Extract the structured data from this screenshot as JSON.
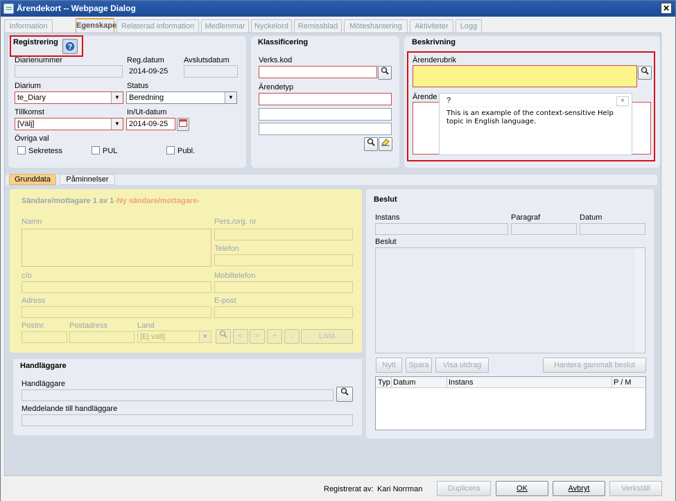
{
  "window": {
    "title": "Ärendekort -- Webpage Dialog",
    "close": "✕"
  },
  "tabs": [
    {
      "label": "Information",
      "active": false
    },
    {
      "label": "Egenskaper",
      "active": true
    },
    {
      "label": "Relaterad information",
      "active": false
    },
    {
      "label": "Medlemmar",
      "active": false
    },
    {
      "label": "Nyckelord",
      "active": false
    },
    {
      "label": "Remissblad",
      "active": false
    },
    {
      "label": "Möteshantering",
      "active": false
    },
    {
      "label": "Aktiviteter",
      "active": false
    },
    {
      "label": "Logg",
      "active": false
    }
  ],
  "registrering": {
    "title": "Registrering",
    "help_icon": "question-circle-icon",
    "diarienummer_label": "Diarienummer",
    "diarienummer_value": "",
    "regdatum_label": "Reg.datum",
    "regdatum_value": "2014-09-25",
    "avslutsdatum_label": "Avslutsdatum",
    "diarium_label": "Diarium",
    "diarium_value": "te_Diary",
    "status_label": "Status",
    "status_value": "Beredning",
    "tillkomst_label": "Tillkomst",
    "tillkomst_value": "[Välj]",
    "inut_label": "In/Ut-datum",
    "inut_value": "2014-09-25",
    "ovriga_label": "Övriga val",
    "sekretess": "Sekretess",
    "pul": "PUL",
    "publ": "Publ."
  },
  "klassificering": {
    "title": "Klassificering",
    "verkskod_label": "Verks.kod",
    "arendetyp_label": "Ärendetyp"
  },
  "beskrivning": {
    "title": "Beskrivning",
    "arenderubrik_label": "Ärenderubrik",
    "arendemening_label": "Ärende"
  },
  "help_popup": {
    "title": "?",
    "close": "×",
    "message": "This is an example of the context-sensitive Help topic in English language."
  },
  "subtabs": {
    "grunddata": "Grunddata",
    "paminnelser": "Påminnelser"
  },
  "sender": {
    "header": "Sändare/mottagare 1 av 1",
    "new_link": "-Ny sändare/mottagare-",
    "namn": "Namn",
    "persorg": "Pers./org. nr",
    "telefon": "Telefon",
    "co": "c/o",
    "mobil": "Mobiltelefon",
    "adress": "Adress",
    "epost": "E-post",
    "postnr": "Postnr.",
    "postadress": "Postadress",
    "land": "Land",
    "land_value": "[Ej valt]",
    "lista": "Lista",
    "nav": [
      "<",
      ">",
      "+",
      "-"
    ]
  },
  "beslut": {
    "title": "Beslut",
    "instans": "Instans",
    "paragraf": "Paragraf",
    "datum": "Datum",
    "beslut_label": "Beslut",
    "nytt": "Nytt",
    "spara": "Spara",
    "visa_utdrag": "Visa utdrag",
    "hantera": "Hantera gammalt beslut",
    "columns": [
      "Typ",
      "Datum",
      "Instans",
      "P / M"
    ]
  },
  "handlaggare": {
    "title": "Handläggare",
    "handlaggare_label": "Handläggare",
    "meddelande_label": "Meddelande till handläggare"
  },
  "footer": {
    "registrerat_label": "Registrerat av:",
    "registrerat_value": "Kari Norrman",
    "duplicera": "Duplicera",
    "ok": "OK",
    "avbryt": "Avbryt",
    "verkstall": "Verkställ"
  }
}
